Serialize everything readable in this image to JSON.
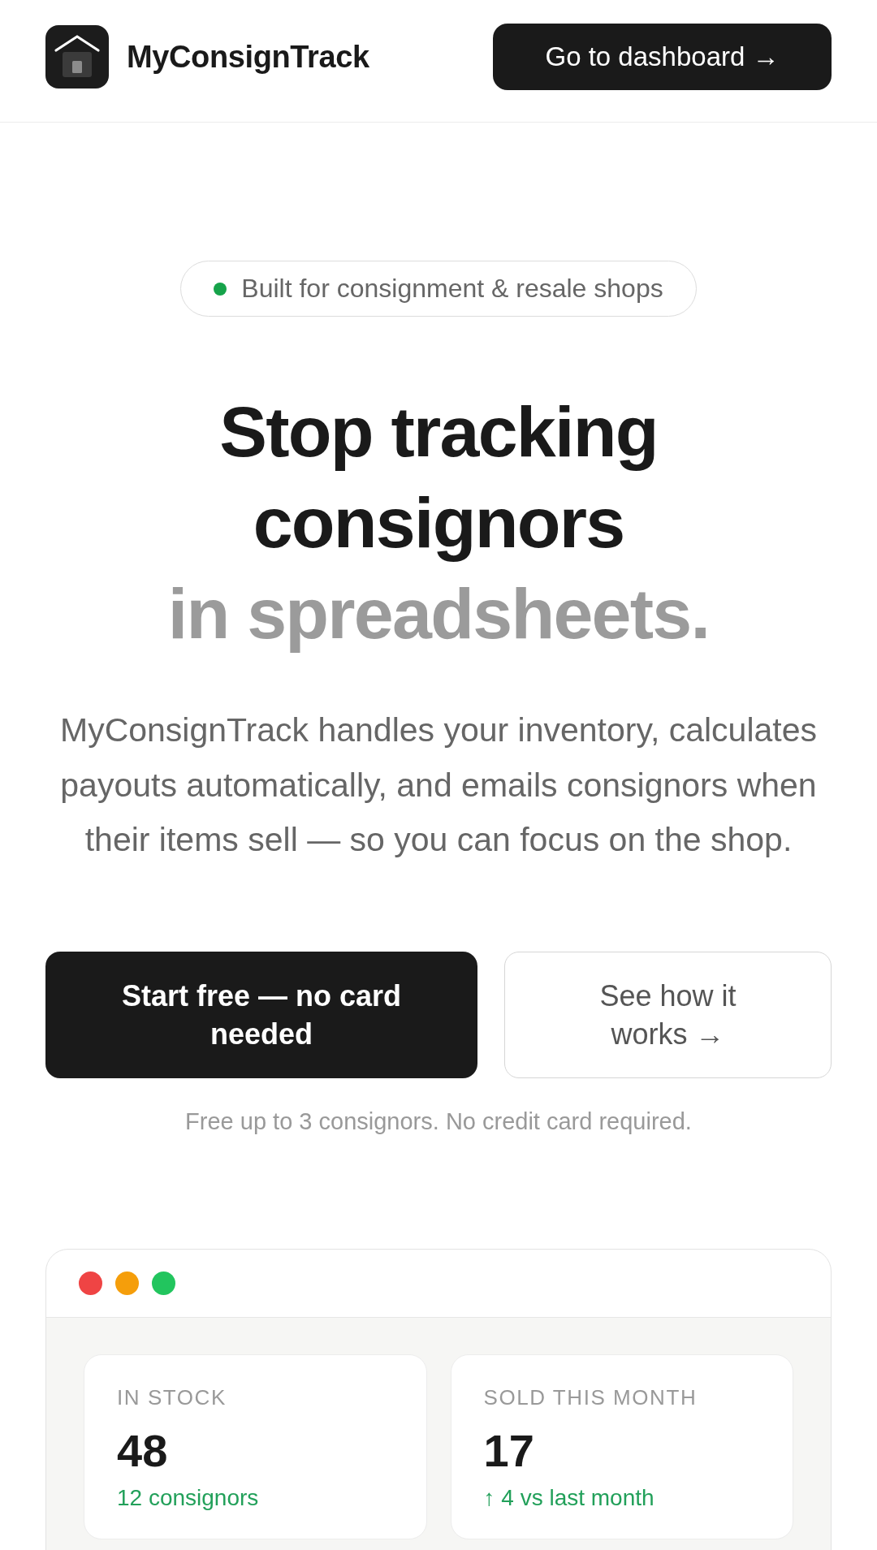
{
  "header": {
    "brand": "MyConsignTrack",
    "cta": "Go to dashboard →"
  },
  "hero": {
    "badge": "Built for consignment & resale shops",
    "headline": [
      {
        "text": "Stop tracking consignors",
        "muted": false
      },
      {
        "text": "in spreadsheets.",
        "muted": true
      }
    ],
    "description": "MyConsignTrack handles your inventory, calculates payouts automatically, and emails consignors when their items sell — so you can focus on the shop.",
    "actions": [
      {
        "label": "Start free — no card needed",
        "kind": "primary"
      },
      {
        "label": "See how it works →",
        "kind": "secondary"
      }
    ],
    "note": "Free up to 3 consignors. No credit card required."
  },
  "preview": {
    "window_dots": [
      {
        "color": "#ef4444"
      },
      {
        "color": "#f59e0b"
      },
      {
        "color": "#22c55e"
      }
    ],
    "stats": [
      {
        "label": "IN STOCK",
        "value": "48",
        "detail": "12 consignors"
      },
      {
        "label": "SOLD THIS MONTH",
        "value": "17",
        "detail": "↑ 4 vs last month"
      }
    ]
  }
}
